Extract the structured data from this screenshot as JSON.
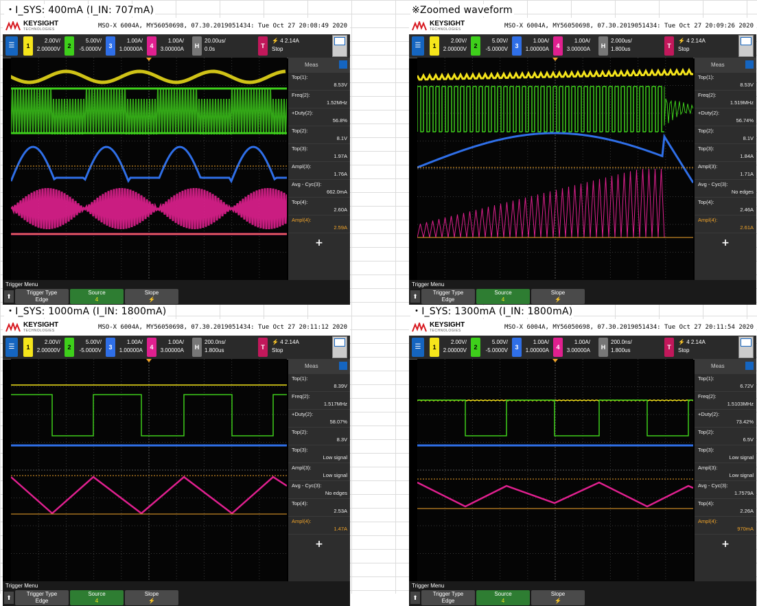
{
  "colors": {
    "ch1": "#f5e51b",
    "ch2": "#3ecf1b",
    "ch3": "#2f6fe8",
    "ch4": "#e0208f",
    "trig": "#c2185b",
    "ref": "#f2a52a"
  },
  "panels": [
    {
      "caption": "・I_SYS: 400mA (I_IN: 707mA)",
      "brand": "KEYSIGHT",
      "brand_sub": "TECHNOLOGIES",
      "model": "MSO-X 6004A, MY56050698, 07.30.2019051434: Tue Oct 27 20:08:49 2020",
      "ch": [
        {
          "n": "1",
          "v1": "2.00V/",
          "v2": "2.00000V"
        },
        {
          "n": "2",
          "v1": "5.00V/",
          "v2": "-5.0000V"
        },
        {
          "n": "3",
          "v1": "1.00A/",
          "v2": "1.00000A"
        },
        {
          "n": "4",
          "v1": "1.00A/",
          "v2": "3.00000A"
        }
      ],
      "h": {
        "label": "H",
        "v1": "20.00us/",
        "v2": "0.0s"
      },
      "trig": {
        "label": "T",
        "src": "4",
        "level": "2.14A",
        "state": "Stop"
      },
      "meas_title": "Meas",
      "meas": [
        {
          "l": "Top(1):",
          "v": "8.53V"
        },
        {
          "l": "Freq(2):",
          "v": "1.52MHz"
        },
        {
          "l": "+Duty(2):",
          "v": "56.8%"
        },
        {
          "l": "Top(2):",
          "v": "8.1V"
        },
        {
          "l": "Top(3):",
          "v": "1.97A"
        },
        {
          "l": "Ampl(3):",
          "v": "1.76A"
        },
        {
          "l": "Avg - Cyc(3):",
          "v": "662.0mA"
        },
        {
          "l": "Top(4):",
          "v": "2.60A"
        },
        {
          "l": "Ampl(4):",
          "v": "2.59A"
        }
      ],
      "plus": "+",
      "footer": {
        "title": "Trigger Menu",
        "b1": [
          "Trigger Type",
          "Edge"
        ],
        "b2": [
          "Source",
          "4"
        ],
        "b3": [
          "Slope",
          "⚡"
        ]
      }
    },
    {
      "caption": "※Zoomed waveform",
      "brand": "KEYSIGHT",
      "brand_sub": "TECHNOLOGIES",
      "model": "MSO-X 6004A, MY56050698, 07.30.2019051434: Tue Oct 27 20:09:26 2020",
      "ch": [
        {
          "n": "1",
          "v1": "2.00V/",
          "v2": "2.00000V"
        },
        {
          "n": "2",
          "v1": "5.00V/",
          "v2": "-5.0000V"
        },
        {
          "n": "3",
          "v1": "1.00A/",
          "v2": "1.00000A"
        },
        {
          "n": "4",
          "v1": "1.00A/",
          "v2": "3.00000A"
        }
      ],
      "h": {
        "label": "H",
        "v1": "2.000us/",
        "v2": "1.800us"
      },
      "trig": {
        "label": "T",
        "src": "4",
        "level": "2.14A",
        "state": "Stop"
      },
      "meas_title": "Meas",
      "meas": [
        {
          "l": "Top(1):",
          "v": "8.53V"
        },
        {
          "l": "Freq(2):",
          "v": "1.519MHz"
        },
        {
          "l": "+Duty(2):",
          "v": "56.74%"
        },
        {
          "l": "Top(2):",
          "v": "8.1V"
        },
        {
          "l": "Top(3):",
          "v": "1.84A"
        },
        {
          "l": "Ampl(3):",
          "v": "1.71A"
        },
        {
          "l": "Avg - Cyc(3):",
          "v": "No edges"
        },
        {
          "l": "Top(4):",
          "v": "2.46A"
        },
        {
          "l": "Ampl(4):",
          "v": "2.61A"
        }
      ],
      "plus": "+",
      "footer": {
        "title": "Trigger Menu",
        "b1": [
          "Trigger Type",
          "Edge"
        ],
        "b2": [
          "Source",
          "4"
        ],
        "b3": [
          "Slope",
          "⚡"
        ]
      }
    },
    {
      "caption": "・I_SYS: 1000mA (I_IN: 1800mA)",
      "brand": "KEYSIGHT",
      "brand_sub": "TECHNOLOGIES",
      "model": "MSO-X 6004A, MY56050698, 07.30.2019051434: Tue Oct 27 20:11:12 2020",
      "ch": [
        {
          "n": "1",
          "v1": "2.00V/",
          "v2": "2.00000V"
        },
        {
          "n": "2",
          "v1": "5.00V/",
          "v2": "-5.0000V"
        },
        {
          "n": "3",
          "v1": "1.00A/",
          "v2": "1.00000A"
        },
        {
          "n": "4",
          "v1": "1.00A/",
          "v2": "3.00000A"
        }
      ],
      "h": {
        "label": "H",
        "v1": "200.0ns/",
        "v2": "1.800us"
      },
      "trig": {
        "label": "T",
        "src": "4",
        "level": "2.14A",
        "state": "Stop"
      },
      "meas_title": "Meas",
      "meas": [
        {
          "l": "Top(1):",
          "v": "8.39V"
        },
        {
          "l": "Freq(2):",
          "v": "1.517MHz"
        },
        {
          "l": "+Duty(2):",
          "v": "58.07%"
        },
        {
          "l": "Top(2):",
          "v": "8.3V"
        },
        {
          "l": "Top(3):",
          "v": "Low signal"
        },
        {
          "l": "Ampl(3):",
          "v": "Low signal"
        },
        {
          "l": "Avg - Cyc(3):",
          "v": "No edges"
        },
        {
          "l": "Top(4):",
          "v": "2.53A"
        },
        {
          "l": "Ampl(4):",
          "v": "1.47A"
        }
      ],
      "plus": "+",
      "footer": {
        "title": "Trigger Menu",
        "b1": [
          "Trigger Type",
          "Edge"
        ],
        "b2": [
          "Source",
          "4"
        ],
        "b3": [
          "Slope",
          "⚡"
        ]
      }
    },
    {
      "caption": "・I_SYS: 1300mA (I_IN: 1800mA)",
      "brand": "KEYSIGHT",
      "brand_sub": "TECHNOLOGIES",
      "model": "MSO-X 6004A, MY56050698, 07.30.2019051434: Tue Oct 27 20:11:54 2020",
      "ch": [
        {
          "n": "1",
          "v1": "2.00V/",
          "v2": "2.00000V"
        },
        {
          "n": "2",
          "v1": "5.00V/",
          "v2": "-5.0000V"
        },
        {
          "n": "3",
          "v1": "1.00A/",
          "v2": "1.00000A"
        },
        {
          "n": "4",
          "v1": "1.00A/",
          "v2": "3.00000A"
        }
      ],
      "h": {
        "label": "H",
        "v1": "200.0ns/",
        "v2": "1.800us"
      },
      "trig": {
        "label": "T",
        "src": "4",
        "level": "2.14A",
        "state": "Stop"
      },
      "meas_title": "Meas",
      "meas": [
        {
          "l": "Top(1):",
          "v": "6.72V"
        },
        {
          "l": "Freq(2):",
          "v": "1.5103MHz"
        },
        {
          "l": "+Duty(2):",
          "v": "73.42%"
        },
        {
          "l": "Top(2):",
          "v": "6.5V"
        },
        {
          "l": "Top(3):",
          "v": "Low signal"
        },
        {
          "l": "Ampl(3):",
          "v": "Low signal"
        },
        {
          "l": "Avg - Cyc(3):",
          "v": "1.7579A"
        },
        {
          "l": "Top(4):",
          "v": "2.26A"
        },
        {
          "l": "Ampl(4):",
          "v": "970mA"
        }
      ],
      "plus": "+",
      "footer": {
        "title": "Trigger Menu",
        "b1": [
          "Trigger Type",
          "Edge"
        ],
        "b2": [
          "Source",
          "4"
        ],
        "b3": [
          "Slope",
          "⚡"
        ]
      }
    }
  ]
}
